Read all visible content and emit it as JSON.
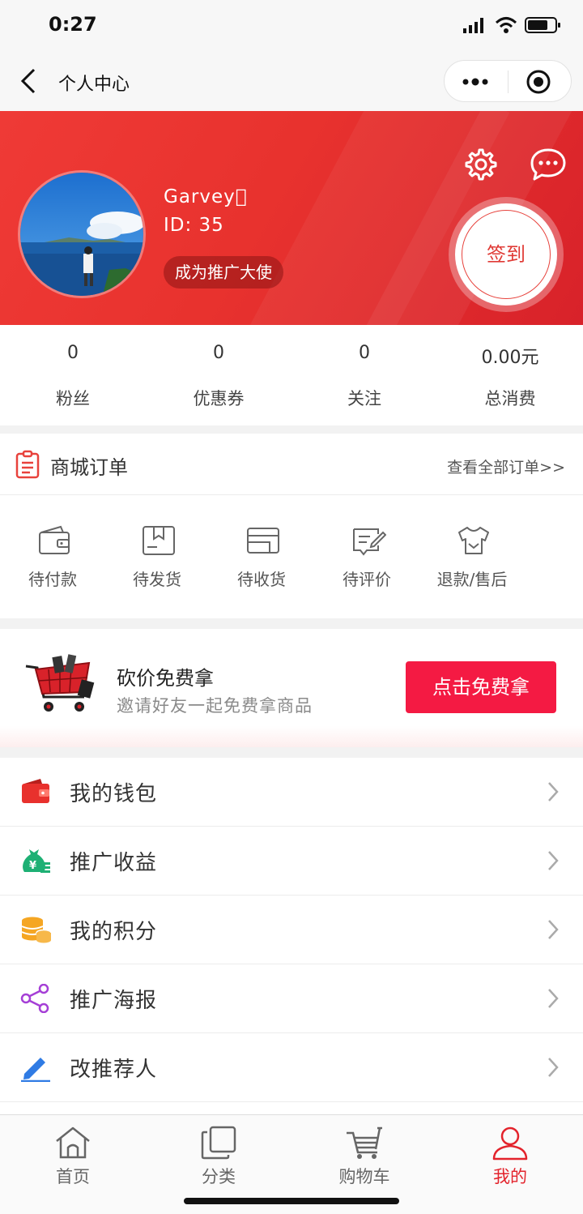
{
  "status": {
    "time": "0:27"
  },
  "nav": {
    "title": "个人中心"
  },
  "profile": {
    "name": "Garvey\u0000",
    "id": "ID: 35",
    "ambassador": "成为推广大使",
    "signin": "签到"
  },
  "stats": [
    {
      "value": "0",
      "label": "粉丝"
    },
    {
      "value": "0",
      "label": "优惠券"
    },
    {
      "value": "0",
      "label": "关注"
    },
    {
      "value": "0.00元",
      "label": "总消费"
    }
  ],
  "orders": {
    "title": "商城订单",
    "view_all": "查看全部订单>>",
    "items": [
      {
        "label": "待付款",
        "icon": "wallet-icon"
      },
      {
        "label": "待发货",
        "icon": "package-icon"
      },
      {
        "label": "待收货",
        "icon": "card-icon"
      },
      {
        "label": "待评价",
        "icon": "review-icon"
      },
      {
        "label": "退款/售后",
        "icon": "shirt-icon"
      }
    ]
  },
  "bargain": {
    "title": "砍价免费拿",
    "subtitle": "邀请好友一起免费拿商品",
    "button": "点击免费拿"
  },
  "menu": [
    {
      "label": "我的钱包",
      "icon": "wallet-icon",
      "color": "#e8312d"
    },
    {
      "label": "推广收益",
      "icon": "money-bag-icon",
      "color": "#1eb074"
    },
    {
      "label": "我的积分",
      "icon": "coins-icon",
      "color": "#f5a623"
    },
    {
      "label": "推广海报",
      "icon": "share-icon",
      "color": "#a53fd6"
    },
    {
      "label": "改推荐人",
      "icon": "pencil-icon",
      "color": "#2f7be4"
    }
  ],
  "tabs": [
    {
      "label": "首页",
      "icon": "home-icon"
    },
    {
      "label": "分类",
      "icon": "category-icon"
    },
    {
      "label": "购物车",
      "icon": "cart-icon"
    },
    {
      "label": "我的",
      "icon": "user-icon",
      "active": true
    }
  ],
  "colors": {
    "brand_red": "#e8322e",
    "active_tab": "#e3232c",
    "bargain_button": "#f41a43"
  }
}
